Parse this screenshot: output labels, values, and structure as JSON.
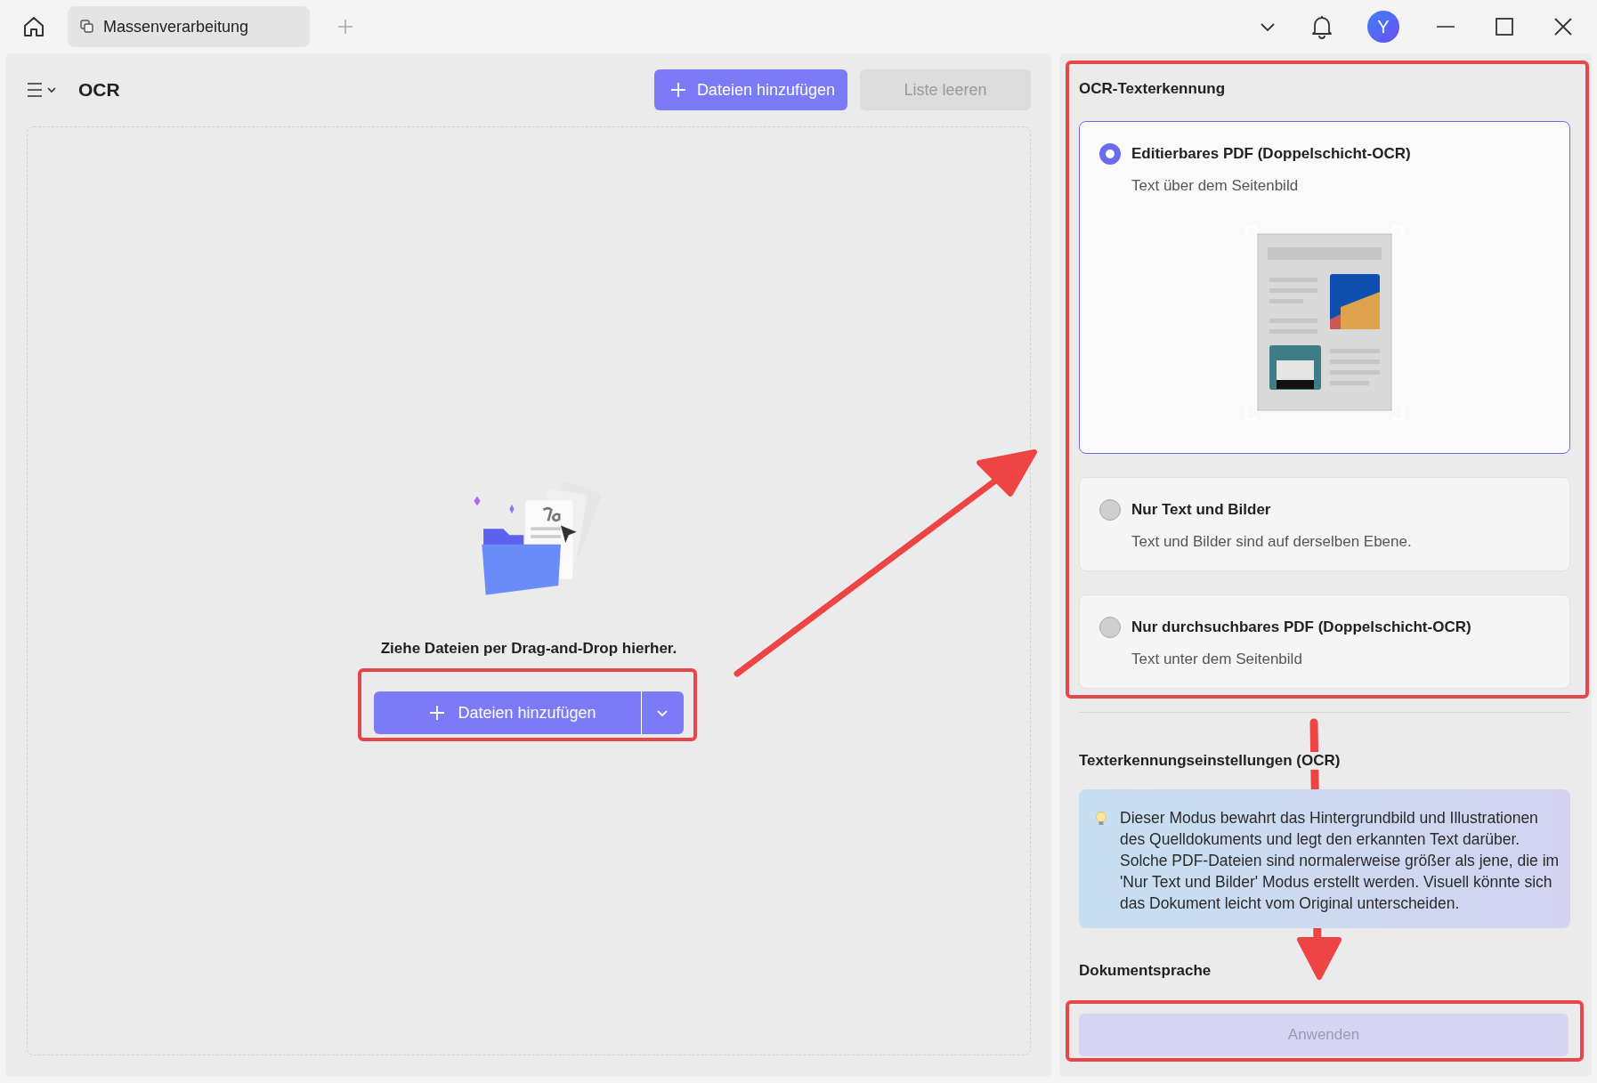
{
  "window": {
    "tab": {
      "title": "Massenverarbeitung",
      "selected": true
    },
    "avatar": "Y"
  },
  "toolbar": {
    "title": "OCR",
    "add_button": "Dateien hinzufügen",
    "clear_button": {
      "label": "Liste leeren",
      "disabled": true
    }
  },
  "drop_zone": {
    "hint": "Ziehe Dateien per Drag-and-Drop hierher.",
    "add_button": "Dateien hinzufügen"
  },
  "ocr_section": {
    "title": "OCR-Texterkennung",
    "options": [
      {
        "title": "Editierbares PDF (Doppelschicht-OCR)",
        "description": "Text über dem Seitenbild",
        "selected": true
      },
      {
        "title": "Nur Text und Bilder",
        "description": "Text und Bilder sind auf derselben Ebene.",
        "selected": false
      },
      {
        "title": "Nur durchsuchbares PDF (Doppelschicht-OCR)",
        "description": "Text unter dem Seitenbild",
        "selected": false
      }
    ]
  },
  "settings": {
    "title": "Texterkennungseinstellungen (OCR)",
    "info": "Dieser Modus bewahrt das Hintergrundbild und Illustrationen des Quelldokuments und legt den erkannten Text darüber. Solche PDF-Dateien sind normalerweise größer als jene, die im 'Nur Text und Bilder' Modus erstellt werden. Visuell könnte sich das Dokument leicht vom Original unterscheiden."
  },
  "language": {
    "title": "Dokumentsprache"
  },
  "apply_button": {
    "label": "Anwenden",
    "disabled": true
  }
}
